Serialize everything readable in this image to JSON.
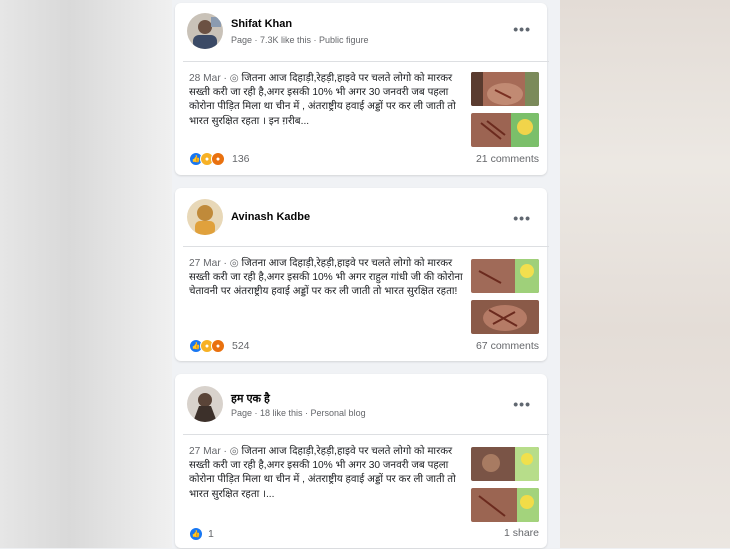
{
  "posts": [
    {
      "author": "Shifat Khan",
      "meta": "Page · 7.3K like this · Public figure",
      "date": "28 Mar ·",
      "text": "जितना आज दिहाड़ी,रेहड़ी,हाइवे पर चलते लोगो को मारकर सख्ती करी जा रही है,अगर इसकी 10% भी अगर 30 जनवरी जब पहला कोरोना पीड़ित मिला था चीन में , अंतराष्ट्रीय हवाई अड्डों पर कर ली जाती तो भारत सुरक्षित रहता । इन ग़रीब...",
      "reaction_count": "136",
      "footer_right": "21 comments",
      "reactions": [
        "like-icon",
        "sad-icon",
        "angry-icon"
      ]
    },
    {
      "author": "Avinash Kadbe",
      "meta": "",
      "date": "27 Mar ·",
      "text": "जितना आज दिहाड़ी,रेहड़ी,हाइवे पर चलते लोगो को मारकर सख्ती करी जा रही है,अगर इसकी 10% भी अगर राहुल गांधी जी की कोरोना चेतावनी पर अंतराष्ट्रीय हवाई अड्डों पर कर ली जाती तो भारत सुरक्षित रहता!",
      "reaction_count": "524",
      "footer_right": "67 comments",
      "reactions": [
        "like-icon",
        "sad-icon",
        "angry-icon"
      ]
    },
    {
      "author": "हम एक है",
      "meta": "Page · 18 like this · Personal blog",
      "date": "27 Mar ·",
      "text": "जितना आज दिहाड़ी,रेहड़ी,हाइवे पर चलते लोगो को मारकर सख्ती करी जा रही है,अगर इसकी 10% भी अगर 30 जनवरी जब पहला कोरोना पीड़ित मिला था चीन में , अंतराष्ट्रीय हवाई अड्डों पर कर ली जाती तो भारत सुरक्षित रहता ।...",
      "reaction_count": "1",
      "footer_right": "1 share",
      "reactions": [
        "like-icon"
      ]
    }
  ],
  "colors": {
    "like": "#1877f2",
    "sad": "#f7b125",
    "angry": "#e9710f",
    "text_primary": "#050505",
    "text_secondary": "#65676b"
  }
}
